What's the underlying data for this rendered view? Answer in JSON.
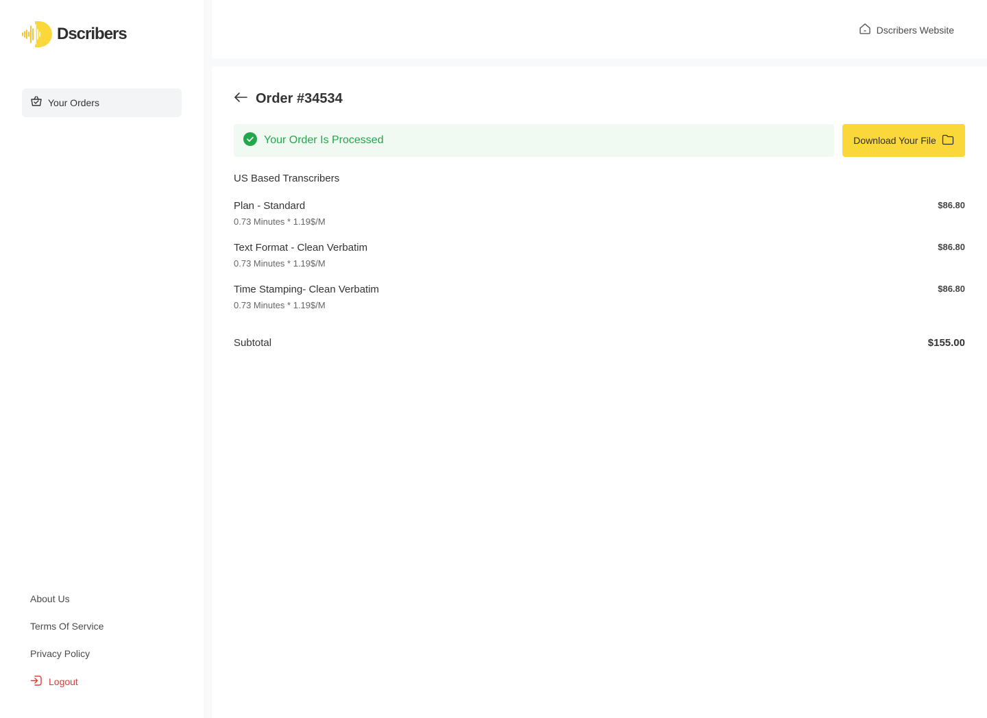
{
  "brand": {
    "name": "Dscribers",
    "accent": "#fbd83a"
  },
  "sidebar": {
    "nav": [
      {
        "label": "Your Orders",
        "icon": "basket-icon"
      }
    ],
    "footer_links": [
      "About Us",
      "Terms Of Service",
      "Privacy Policy"
    ],
    "logout_label": "Logout"
  },
  "header": {
    "site_link_label": "Dscribers Website"
  },
  "order": {
    "title": "Order #34534",
    "status_text": "Your Order Is  Processed",
    "download_label": "Download Your File",
    "section_title": "US Based Transcribers",
    "items": [
      {
        "name": "Plan - Standard",
        "detail": "0.73 Minutes * 1.19$/M",
        "price": "$86.80"
      },
      {
        "name": "Text Format - Clean Verbatim",
        "detail": "0.73 Minutes * 1.19$/M",
        "price": "$86.80"
      },
      {
        "name": "Time Stamping- Clean Verbatim",
        "detail": "0.73 Minutes * 1.19$/M",
        "price": "$86.80"
      }
    ],
    "subtotal_label": "Subtotal",
    "subtotal_value": "$155.00"
  }
}
